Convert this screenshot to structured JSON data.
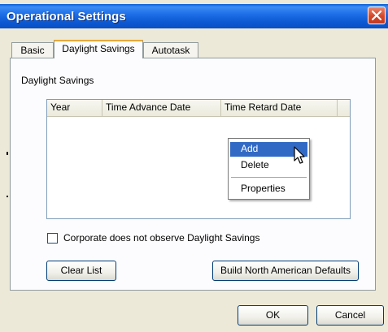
{
  "window": {
    "title": "Operational Settings"
  },
  "tabs": [
    {
      "label": "Basic",
      "selected": false
    },
    {
      "label": "Daylight Savings",
      "selected": true
    },
    {
      "label": "Autotask",
      "selected": false
    }
  ],
  "group": {
    "label": "Daylight Savings"
  },
  "listview": {
    "columns": [
      "Year",
      "Time Advance Date",
      "Time Retard Date"
    ],
    "rows": []
  },
  "context_menu": {
    "items": [
      "Add",
      "Delete",
      "Properties"
    ],
    "highlighted": "Add"
  },
  "checkbox": {
    "label": "Corporate does not observe Daylight Savings",
    "checked": false
  },
  "buttons": {
    "clear_list": "Clear List",
    "build_defaults": "Build North American Defaults",
    "ok": "OK",
    "cancel": "Cancel"
  },
  "colors": {
    "titlebar": "#0a5fd8",
    "menu_highlight": "#316ac5",
    "dialog_bg": "#ece9d8"
  }
}
